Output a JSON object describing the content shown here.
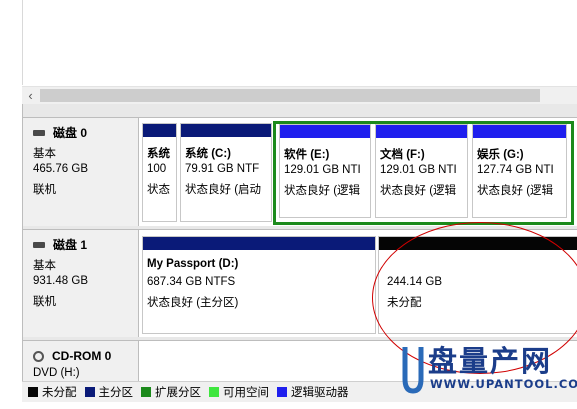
{
  "scrollbar": {
    "left_arrow": "‹"
  },
  "disks": [
    {
      "name": "磁盘 0",
      "type": "基本",
      "size": "465.76 GB",
      "status": "联机",
      "partitions": [
        {
          "name": "系统",
          "line2": "100",
          "line3": "状态"
        },
        {
          "name": "系统  (C:)",
          "line2": "79.91 GB NTF",
          "line3": "状态良好 (启动"
        },
        {
          "name": "软件  (E:)",
          "line2": "129.01 GB NTI",
          "line3": "状态良好 (逻辑"
        },
        {
          "name": "文档  (F:)",
          "line2": "129.01 GB NTI",
          "line3": "状态良好 (逻辑"
        },
        {
          "name": "娱乐  (G:)",
          "line2": "127.74 GB NTI",
          "line3": "状态良好 (逻辑"
        }
      ]
    },
    {
      "name": "磁盘 1",
      "type": "基本",
      "size": "931.48 GB",
      "status": "联机",
      "partitions": [
        {
          "name": "My Passport  (D:)",
          "line2": "687.34 GB NTFS",
          "line3": "状态良好 (主分区)"
        },
        {
          "name": "",
          "line2": "244.14 GB",
          "line3": "未分配"
        }
      ]
    },
    {
      "name": "CD-ROM 0",
      "type": "DVD (H:)"
    }
  ],
  "legend": [
    {
      "label": "未分配",
      "color": "#050505"
    },
    {
      "label": "主分区",
      "color": "#0a1a78"
    },
    {
      "label": "扩展分区",
      "color": "#1c8a1c"
    },
    {
      "label": "可用空间",
      "color": "#3ee63e"
    },
    {
      "label": "逻辑驱动器",
      "color": "#1f1fee"
    }
  ],
  "watermark": {
    "brand": "盘量产网",
    "url": "WWW.UPANTOOL.COM"
  }
}
